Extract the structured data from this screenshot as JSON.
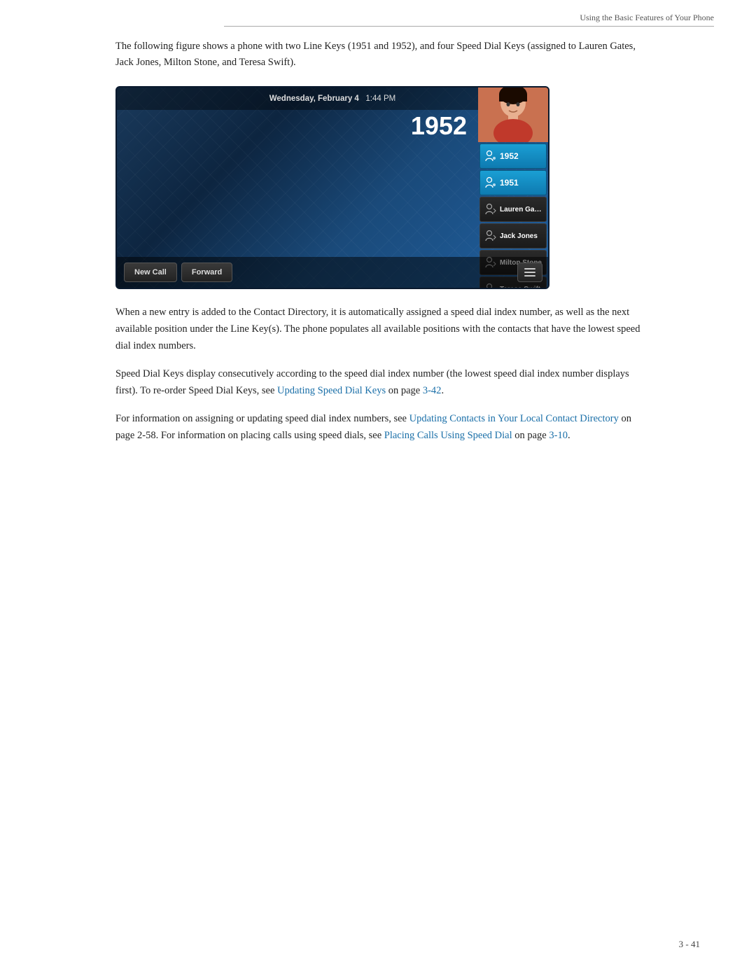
{
  "header": {
    "title": "Using the Basic Features of Your Phone"
  },
  "intro": {
    "text": "The following figure shows a phone with two Line Keys (1951 and 1952), and four Speed Dial Keys (assigned to Lauren Gates, Jack Jones, Milton Stone, and Teresa Swift)."
  },
  "phone": {
    "statusbar": {
      "date": "Wednesday, February 4",
      "time": "1:44 PM"
    },
    "number": "1952",
    "keys": [
      {
        "type": "line",
        "label": "1952"
      },
      {
        "type": "line",
        "label": "1951"
      },
      {
        "type": "speed",
        "label": "Lauren Gates"
      },
      {
        "type": "speed",
        "label": "Jack Jones"
      },
      {
        "type": "speed",
        "label": "Milton Stone"
      },
      {
        "type": "speed",
        "label": "Teresa Swift"
      }
    ],
    "buttons": [
      {
        "id": "new-call",
        "label": "New Call"
      },
      {
        "id": "forward",
        "label": "Forward"
      }
    ]
  },
  "paragraphs": [
    {
      "id": "para1",
      "text": "When a new entry is added to the Contact Directory, it is automatically assigned a speed dial index number, as well as the next available position under the Line Key(s). The phone populates all available positions with the contacts that have the lowest speed dial index numbers."
    },
    {
      "id": "para2",
      "parts": [
        {
          "type": "text",
          "content": "Speed Dial Keys display consecutively according to the speed dial index number (the lowest speed dial index number displays first). To re-order Speed Dial Keys, see "
        },
        {
          "type": "link",
          "content": "Updating Speed Dial Keys"
        },
        {
          "type": "text",
          "content": " on page "
        },
        {
          "type": "link",
          "content": "3-42"
        },
        {
          "type": "text",
          "content": "."
        }
      ]
    },
    {
      "id": "para3",
      "parts": [
        {
          "type": "text",
          "content": "For information on assigning or updating speed dial index numbers, see "
        },
        {
          "type": "link",
          "content": "Updating Contacts in Your Local Contact Directory"
        },
        {
          "type": "text",
          "content": " on page 2-58. For information on placing calls using speed dials, see "
        },
        {
          "type": "link",
          "content": "Placing Calls Using Speed Dial"
        },
        {
          "type": "text",
          "content": " on page "
        },
        {
          "type": "link",
          "content": "3-10"
        },
        {
          "type": "text",
          "content": "."
        }
      ]
    }
  ],
  "footer": {
    "page": "3 - 41"
  }
}
